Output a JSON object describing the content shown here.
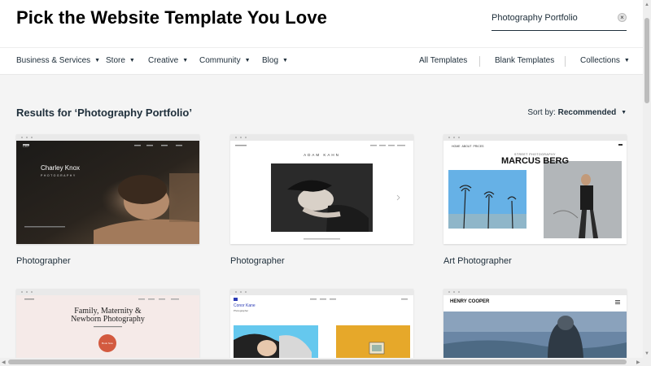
{
  "header": {
    "title": "Pick the Website Template You Love",
    "search_value": "Photography Portfolio",
    "clear_symbol": "×"
  },
  "nav": {
    "left_items": [
      {
        "label": "Business & Services"
      },
      {
        "label": "Store"
      },
      {
        "label": "Creative"
      },
      {
        "label": "Community"
      },
      {
        "label": "Blog"
      }
    ],
    "right_items": [
      {
        "label": "All Templates"
      },
      {
        "label": "Blank Templates"
      },
      {
        "label": "Collections"
      }
    ],
    "chevron": "▼"
  },
  "results": {
    "title": "Results for ‘Photography Portfolio’",
    "sort_label": "Sort by:",
    "sort_value": "Recommended"
  },
  "cards": [
    {
      "label": "Photographer",
      "preview": {
        "name": "Charley Knox",
        "subtitle": "PHOTOGRAPHY",
        "logo": "CKP"
      }
    },
    {
      "label": "Photographer",
      "preview": {
        "name": "ADAM KAHN"
      }
    },
    {
      "label": "Art Photographer",
      "preview": {
        "name": "MARCUS BERG",
        "subtitle": "STREET PHOTOGRAPHY",
        "menu": [
          "HOME",
          "ABOUT",
          "PRICES"
        ]
      }
    },
    {
      "label": "",
      "preview": {
        "headline": "Family, Maternity & Newborn Photography",
        "button": "Book Now"
      }
    },
    {
      "label": "",
      "preview": {
        "name": "Conor Kane",
        "subtitle": "Photographer"
      }
    },
    {
      "label": "",
      "preview": {
        "name": "HENRY COOPER"
      }
    }
  ],
  "colors": {
    "accent": "#20303c",
    "background": "#f4f4f4",
    "book_button": "#d35a3f"
  }
}
